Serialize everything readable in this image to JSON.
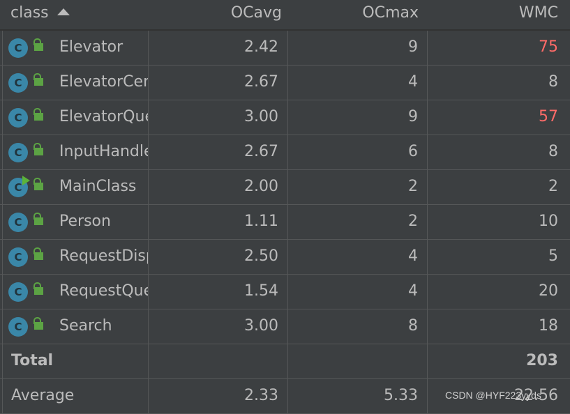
{
  "header": {
    "columns": [
      "class",
      "OCavg",
      "OCmax",
      "WMC"
    ],
    "sort_column": "class",
    "sort_direction": "ascending"
  },
  "rows": [
    {
      "name": "Elevator",
      "ocavg": "2.42",
      "ocmax": "9",
      "wmc": "75",
      "wmc_alert": true,
      "runnable": false
    },
    {
      "name": "ElevatorCenter",
      "ocavg": "2.67",
      "ocmax": "4",
      "wmc": "8",
      "wmc_alert": false,
      "runnable": false
    },
    {
      "name": "ElevatorQueue",
      "ocavg": "3.00",
      "ocmax": "9",
      "wmc": "57",
      "wmc_alert": true,
      "runnable": false
    },
    {
      "name": "InputHandler",
      "ocavg": "2.67",
      "ocmax": "6",
      "wmc": "8",
      "wmc_alert": false,
      "runnable": false
    },
    {
      "name": "MainClass",
      "ocavg": "2.00",
      "ocmax": "2",
      "wmc": "2",
      "wmc_alert": false,
      "runnable": true
    },
    {
      "name": "Person",
      "ocavg": "1.11",
      "ocmax": "2",
      "wmc": "10",
      "wmc_alert": false,
      "runnable": false
    },
    {
      "name": "RequestDispatcher",
      "ocavg": "2.50",
      "ocmax": "4",
      "wmc": "5",
      "wmc_alert": false,
      "runnable": false
    },
    {
      "name": "RequestQueue",
      "ocavg": "1.54",
      "ocmax": "4",
      "wmc": "20",
      "wmc_alert": false,
      "runnable": false
    },
    {
      "name": "Search",
      "ocavg": "3.00",
      "ocmax": "8",
      "wmc": "18",
      "wmc_alert": false,
      "runnable": false
    }
  ],
  "total": {
    "label": "Total",
    "ocavg": "",
    "ocmax": "",
    "wmc": "203"
  },
  "average": {
    "label": "Average",
    "ocavg": "2.33",
    "ocmax": "5.33",
    "wmc": "22.56"
  },
  "watermark": "CSDN @HYF223yyds",
  "colors": {
    "background": "#3c3f41",
    "text": "#bbbbbb",
    "alert": "#ff6b68",
    "class_icon": "#3a87a8",
    "lock_icon": "#5ca344"
  },
  "icons": {
    "class": "class-c-icon",
    "access": "unlocked-padlock-icon",
    "run": "run-triangle-icon",
    "sort": "sort-ascending-icon"
  }
}
